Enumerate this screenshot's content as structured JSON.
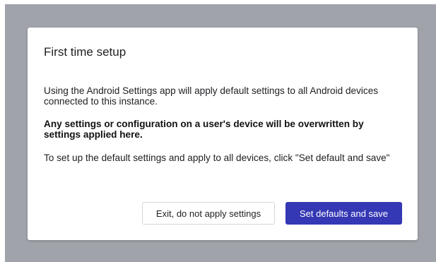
{
  "dialog": {
    "title": "First time setup",
    "paragraph_1": "Using the Android Settings app will apply default settings to all Android devices connected to this instance.",
    "paragraph_2_bold": "Any settings or configuration on a user's device will be overwritten by settings applied here.",
    "paragraph_3": "To set up the default settings and apply to all devices, click \"Set default and save\"",
    "exit_button_label": "Exit, do not apply settings",
    "save_button_label": "Set defaults and save"
  },
  "colors": {
    "backdrop": "#a0a3aa",
    "primary_button": "#3438b4"
  }
}
